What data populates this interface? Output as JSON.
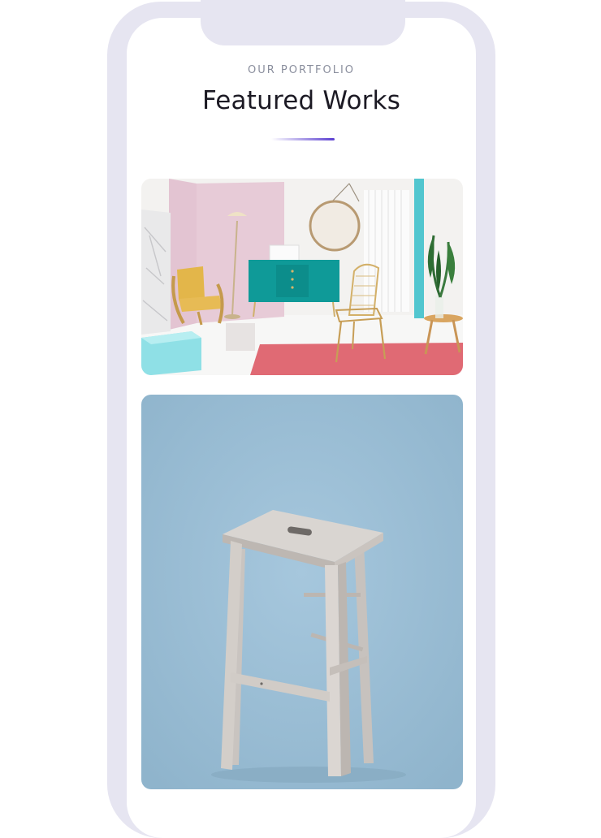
{
  "portfolio": {
    "eyebrow": "OUR PORTFOLIO",
    "title": "Featured Works",
    "items": [
      {
        "name": "pastel-interior-photo",
        "alt": "Pastel interior with chairs, teal sideboard and pink rug"
      },
      {
        "name": "wooden-stool-photo",
        "alt": "Whitewashed wooden bar stool on blue backdrop"
      }
    ]
  },
  "colors": {
    "phone_frame": "#e6e5f1",
    "accent_start": "#ffffff",
    "accent_end": "#5b3fd1",
    "title_text": "#1c1a24",
    "eyebrow_text": "#8a8e9d",
    "stool_backdrop": "#a3c4db"
  }
}
